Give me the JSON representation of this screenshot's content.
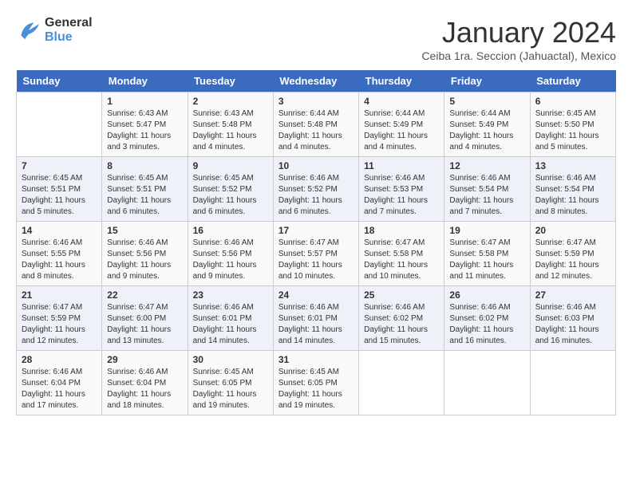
{
  "logo": {
    "line1": "General",
    "line2": "Blue"
  },
  "title": "January 2024",
  "location": "Ceiba 1ra. Seccion (Jahuactal), Mexico",
  "days_of_week": [
    "Sunday",
    "Monday",
    "Tuesday",
    "Wednesday",
    "Thursday",
    "Friday",
    "Saturday"
  ],
  "weeks": [
    [
      {
        "day": "",
        "sunrise": "",
        "sunset": "",
        "daylight": ""
      },
      {
        "day": "1",
        "sunrise": "Sunrise: 6:43 AM",
        "sunset": "Sunset: 5:47 PM",
        "daylight": "Daylight: 11 hours and 3 minutes."
      },
      {
        "day": "2",
        "sunrise": "Sunrise: 6:43 AM",
        "sunset": "Sunset: 5:48 PM",
        "daylight": "Daylight: 11 hours and 4 minutes."
      },
      {
        "day": "3",
        "sunrise": "Sunrise: 6:44 AM",
        "sunset": "Sunset: 5:48 PM",
        "daylight": "Daylight: 11 hours and 4 minutes."
      },
      {
        "day": "4",
        "sunrise": "Sunrise: 6:44 AM",
        "sunset": "Sunset: 5:49 PM",
        "daylight": "Daylight: 11 hours and 4 minutes."
      },
      {
        "day": "5",
        "sunrise": "Sunrise: 6:44 AM",
        "sunset": "Sunset: 5:49 PM",
        "daylight": "Daylight: 11 hours and 4 minutes."
      },
      {
        "day": "6",
        "sunrise": "Sunrise: 6:45 AM",
        "sunset": "Sunset: 5:50 PM",
        "daylight": "Daylight: 11 hours and 5 minutes."
      }
    ],
    [
      {
        "day": "7",
        "sunrise": "Sunrise: 6:45 AM",
        "sunset": "Sunset: 5:51 PM",
        "daylight": "Daylight: 11 hours and 5 minutes."
      },
      {
        "day": "8",
        "sunrise": "Sunrise: 6:45 AM",
        "sunset": "Sunset: 5:51 PM",
        "daylight": "Daylight: 11 hours and 6 minutes."
      },
      {
        "day": "9",
        "sunrise": "Sunrise: 6:45 AM",
        "sunset": "Sunset: 5:52 PM",
        "daylight": "Daylight: 11 hours and 6 minutes."
      },
      {
        "day": "10",
        "sunrise": "Sunrise: 6:46 AM",
        "sunset": "Sunset: 5:52 PM",
        "daylight": "Daylight: 11 hours and 6 minutes."
      },
      {
        "day": "11",
        "sunrise": "Sunrise: 6:46 AM",
        "sunset": "Sunset: 5:53 PM",
        "daylight": "Daylight: 11 hours and 7 minutes."
      },
      {
        "day": "12",
        "sunrise": "Sunrise: 6:46 AM",
        "sunset": "Sunset: 5:54 PM",
        "daylight": "Daylight: 11 hours and 7 minutes."
      },
      {
        "day": "13",
        "sunrise": "Sunrise: 6:46 AM",
        "sunset": "Sunset: 5:54 PM",
        "daylight": "Daylight: 11 hours and 8 minutes."
      }
    ],
    [
      {
        "day": "14",
        "sunrise": "Sunrise: 6:46 AM",
        "sunset": "Sunset: 5:55 PM",
        "daylight": "Daylight: 11 hours and 8 minutes."
      },
      {
        "day": "15",
        "sunrise": "Sunrise: 6:46 AM",
        "sunset": "Sunset: 5:56 PM",
        "daylight": "Daylight: 11 hours and 9 minutes."
      },
      {
        "day": "16",
        "sunrise": "Sunrise: 6:46 AM",
        "sunset": "Sunset: 5:56 PM",
        "daylight": "Daylight: 11 hours and 9 minutes."
      },
      {
        "day": "17",
        "sunrise": "Sunrise: 6:47 AM",
        "sunset": "Sunset: 5:57 PM",
        "daylight": "Daylight: 11 hours and 10 minutes."
      },
      {
        "day": "18",
        "sunrise": "Sunrise: 6:47 AM",
        "sunset": "Sunset: 5:58 PM",
        "daylight": "Daylight: 11 hours and 10 minutes."
      },
      {
        "day": "19",
        "sunrise": "Sunrise: 6:47 AM",
        "sunset": "Sunset: 5:58 PM",
        "daylight": "Daylight: 11 hours and 11 minutes."
      },
      {
        "day": "20",
        "sunrise": "Sunrise: 6:47 AM",
        "sunset": "Sunset: 5:59 PM",
        "daylight": "Daylight: 11 hours and 12 minutes."
      }
    ],
    [
      {
        "day": "21",
        "sunrise": "Sunrise: 6:47 AM",
        "sunset": "Sunset: 5:59 PM",
        "daylight": "Daylight: 11 hours and 12 minutes."
      },
      {
        "day": "22",
        "sunrise": "Sunrise: 6:47 AM",
        "sunset": "Sunset: 6:00 PM",
        "daylight": "Daylight: 11 hours and 13 minutes."
      },
      {
        "day": "23",
        "sunrise": "Sunrise: 6:46 AM",
        "sunset": "Sunset: 6:01 PM",
        "daylight": "Daylight: 11 hours and 14 minutes."
      },
      {
        "day": "24",
        "sunrise": "Sunrise: 6:46 AM",
        "sunset": "Sunset: 6:01 PM",
        "daylight": "Daylight: 11 hours and 14 minutes."
      },
      {
        "day": "25",
        "sunrise": "Sunrise: 6:46 AM",
        "sunset": "Sunset: 6:02 PM",
        "daylight": "Daylight: 11 hours and 15 minutes."
      },
      {
        "day": "26",
        "sunrise": "Sunrise: 6:46 AM",
        "sunset": "Sunset: 6:02 PM",
        "daylight": "Daylight: 11 hours and 16 minutes."
      },
      {
        "day": "27",
        "sunrise": "Sunrise: 6:46 AM",
        "sunset": "Sunset: 6:03 PM",
        "daylight": "Daylight: 11 hours and 16 minutes."
      }
    ],
    [
      {
        "day": "28",
        "sunrise": "Sunrise: 6:46 AM",
        "sunset": "Sunset: 6:04 PM",
        "daylight": "Daylight: 11 hours and 17 minutes."
      },
      {
        "day": "29",
        "sunrise": "Sunrise: 6:46 AM",
        "sunset": "Sunset: 6:04 PM",
        "daylight": "Daylight: 11 hours and 18 minutes."
      },
      {
        "day": "30",
        "sunrise": "Sunrise: 6:45 AM",
        "sunset": "Sunset: 6:05 PM",
        "daylight": "Daylight: 11 hours and 19 minutes."
      },
      {
        "day": "31",
        "sunrise": "Sunrise: 6:45 AM",
        "sunset": "Sunset: 6:05 PM",
        "daylight": "Daylight: 11 hours and 19 minutes."
      },
      {
        "day": "",
        "sunrise": "",
        "sunset": "",
        "daylight": ""
      },
      {
        "day": "",
        "sunrise": "",
        "sunset": "",
        "daylight": ""
      },
      {
        "day": "",
        "sunrise": "",
        "sunset": "",
        "daylight": ""
      }
    ]
  ]
}
